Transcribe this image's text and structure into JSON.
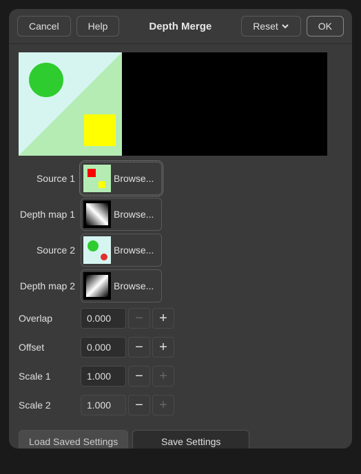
{
  "header": {
    "cancel": "Cancel",
    "help": "Help",
    "title": "Depth Merge",
    "reset": "Reset",
    "ok": "OK"
  },
  "rows": {
    "source1": {
      "label": "Source 1",
      "browse": "Browse..."
    },
    "depthmap1": {
      "label": "Depth map 1",
      "browse": "Browse..."
    },
    "source2": {
      "label": "Source 2",
      "browse": "Browse..."
    },
    "depthmap2": {
      "label": "Depth map 2",
      "browse": "Browse..."
    },
    "overlap": {
      "label": "Overlap",
      "value": "0.000"
    },
    "offset": {
      "label": "Offset",
      "value": "0.000"
    },
    "scale1": {
      "label": "Scale 1",
      "value": "1.000"
    },
    "scale2": {
      "label": "Scale 2",
      "value": "1.000"
    }
  },
  "footer": {
    "load": "Load Saved Settings",
    "save": "Save Settings"
  },
  "icons": {
    "minus": "−",
    "plus": "+"
  }
}
